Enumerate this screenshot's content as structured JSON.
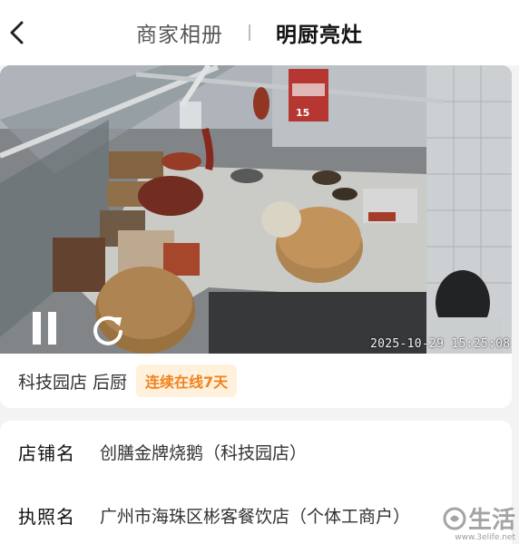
{
  "header": {
    "tabs": [
      {
        "label": "商家相册",
        "active": false
      },
      {
        "label": "明厨亮灶",
        "active": true
      }
    ]
  },
  "video": {
    "timestamp": "2025-10-29 15:25:08",
    "sign_text": "15"
  },
  "location": {
    "name": "科技园店 后厨",
    "badge": "连续在线7天"
  },
  "info": {
    "store": {
      "label": "店铺名",
      "value": "创膳金牌烧鹅（科技园店）"
    },
    "license": {
      "label": "执照名",
      "value": "广州市海珠区彬客餐饮店（个体工商户）"
    }
  },
  "watermark": {
    "brand": "生活",
    "url": "www.3elife.net"
  },
  "colors": {
    "accent_orange": "#f0821e",
    "badge_bg": "#fff1dc",
    "page_bg": "#f3f3f5"
  }
}
